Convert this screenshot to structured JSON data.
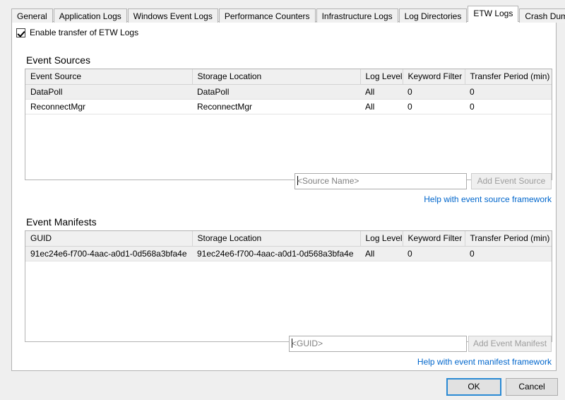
{
  "window": {
    "background_color": "#efefef",
    "panel_color": "#ffffff",
    "accent_color": "#0066cc",
    "default_button_border": "#2a8ad4"
  },
  "tabs": [
    {
      "label": "General",
      "selected": false
    },
    {
      "label": "Application Logs",
      "selected": false
    },
    {
      "label": "Windows Event Logs",
      "selected": false
    },
    {
      "label": "Performance Counters",
      "selected": false
    },
    {
      "label": "Infrastructure Logs",
      "selected": false
    },
    {
      "label": "Log Directories",
      "selected": false
    },
    {
      "label": "ETW Logs",
      "selected": true
    },
    {
      "label": "Crash Dumps",
      "selected": false
    }
  ],
  "enable_checkbox": {
    "label": "Enable transfer of ETW Logs",
    "checked": true,
    "icon": "checkmark-icon"
  },
  "event_sources": {
    "title": "Event Sources",
    "columns": [
      "Event Source",
      "Storage Location",
      "Log Level",
      "Keyword Filter",
      "Transfer Period (min)"
    ],
    "rows": [
      {
        "source": "DataPoll",
        "storage": "DataPoll",
        "log_level": "All",
        "keyword_filter": "0",
        "transfer_period": "0"
      },
      {
        "source": "ReconnectMgr",
        "storage": "ReconnectMgr",
        "log_level": "All",
        "keyword_filter": "0",
        "transfer_period": "0"
      }
    ],
    "input": {
      "value": "",
      "placeholder": "<Source Name>"
    },
    "add_button": {
      "label": "Add Event Source",
      "disabled": true
    },
    "help_link": "Help with event source framework"
  },
  "event_manifests": {
    "title": "Event Manifests",
    "columns": [
      "GUID",
      "Storage Location",
      "Log Level",
      "Keyword Filter",
      "Transfer Period (min)"
    ],
    "rows": [
      {
        "guid": "91ec24e6-f700-4aac-a0d1-0d568a3bfa4e",
        "storage": "91ec24e6-f700-4aac-a0d1-0d568a3bfa4e",
        "log_level": "All",
        "keyword_filter": "0",
        "transfer_period": "0"
      }
    ],
    "input": {
      "value": "",
      "placeholder": "<GUID>"
    },
    "add_button": {
      "label": "Add Event Manifest",
      "disabled": true
    },
    "help_link": "Help with event manifest framework"
  },
  "footer": {
    "ok_label": "OK",
    "cancel_label": "Cancel"
  }
}
